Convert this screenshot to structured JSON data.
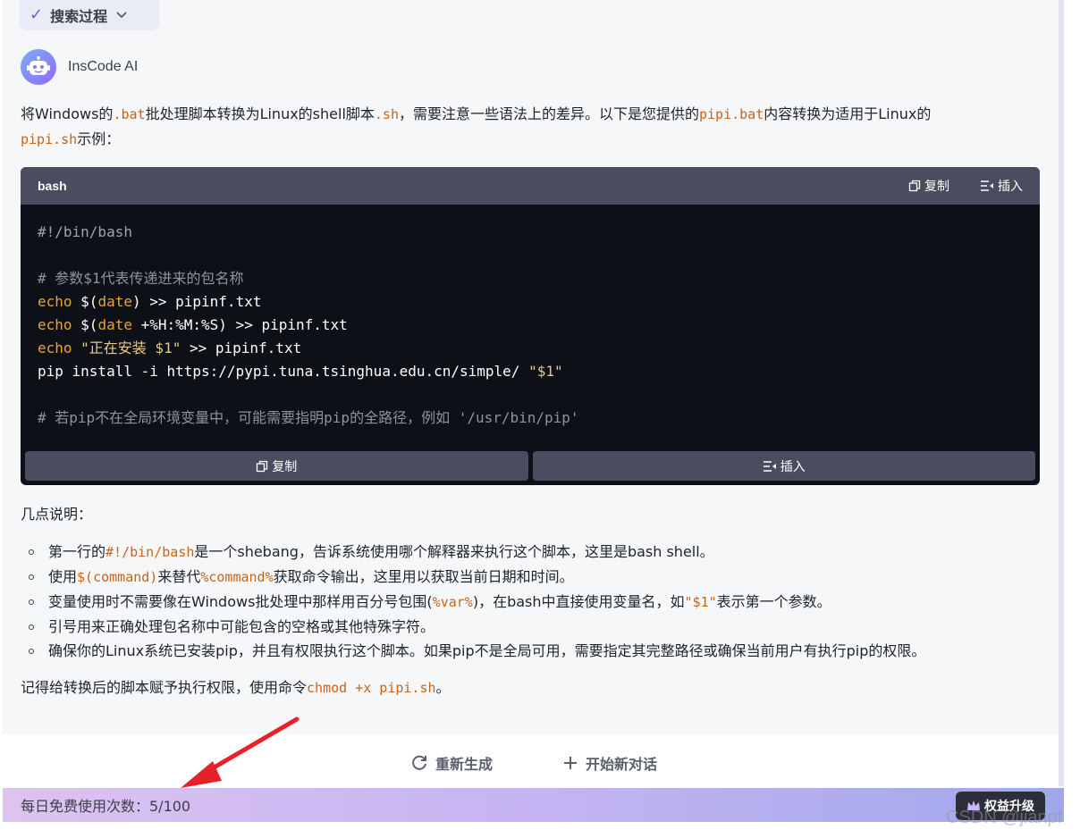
{
  "search_process": {
    "label": "搜索过程"
  },
  "bot": {
    "name": "InsCode AI"
  },
  "intro": {
    "t1": "将Windows的",
    "c1": ".bat",
    "t2": "批处理脚本转换为Linux的shell脚本",
    "c2": ".sh",
    "t3": "，需要注意一些语法上的差异。以下是您提供的",
    "c3": "pipi.bat",
    "t4": "内容转换为适用于Linux的",
    "c4": "pipi.sh",
    "t5": "示例："
  },
  "code_block": {
    "language": "bash",
    "copy_label": "复制",
    "insert_label": "插入",
    "lines": {
      "l1": "#!/bin/bash",
      "l3": "# 参数$1代表传递进来的包名称",
      "l4_kw": "echo",
      "l4_a": " $(",
      "l4_kw2": "date",
      "l4_b": ") >> pipinf.txt",
      "l5_kw": "echo",
      "l5_a": " $(",
      "l5_kw2": "date",
      "l5_b": " +%H:%M:%S) >> pipinf.txt",
      "l6_kw": "echo",
      "l6_str": " \"正在安装 $1\"",
      "l6_b": " >> pipinf.txt",
      "l7_a": "pip install -i https://pypi.tuna.tsinghua.edu.cn/simple/ ",
      "l7_str": "\"$1\"",
      "l9": "# 若pip不在全局环境变量中，可能需要指明pip的全路径，例如 '/usr/bin/pip'"
    }
  },
  "notes": {
    "title": "几点说明：",
    "items": [
      {
        "a": "第一行的",
        "c": "#!/bin/bash",
        "b": "是一个shebang，告诉系统使用哪个解释器来执行这个脚本，这里是bash shell。"
      },
      {
        "a": "使用",
        "c": "$(command)",
        "b": "来替代",
        "c2": "%command%",
        "b2": "获取命令输出，这里用以获取当前日期和时间。"
      },
      {
        "a": "变量使用时不需要像在Windows批处理中那样用百分号包围(",
        "c": "%var%",
        "b": ")，在bash中直接使用变量名，如",
        "c2": "\"$1\"",
        "b2": "表示第一个参数。"
      },
      {
        "a": "引号用来正确处理包名称中可能包含的空格或其他特殊字符。"
      },
      {
        "a": "确保你的Linux系统已安装pip，并且有权限执行这个脚本。如果pip不是全局可用，需要指定其完整路径或确保当前用户有执行pip的权限。"
      }
    ]
  },
  "tip": {
    "a": "记得给转换后的脚本赋予执行权限，使用命令",
    "c": "chmod +x pipi.sh",
    "b": "。"
  },
  "actions": {
    "regenerate": "重新生成",
    "new_chat": "开始新对话"
  },
  "usage": {
    "label": "每日免费使用次数：5/100",
    "upgrade": "权益升级"
  },
  "watermark": "CSDN @jianpf"
}
